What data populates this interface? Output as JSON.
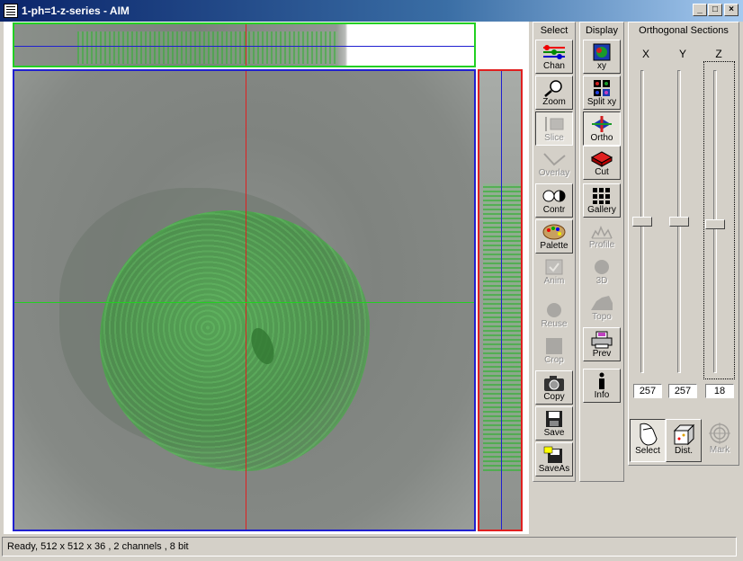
{
  "window": {
    "title": "1-ph=1-z-series - AIM"
  },
  "caption_buttons": {
    "minimize": "_",
    "maximize": "□",
    "close": "×"
  },
  "colors": {
    "xz_border": "#22d022",
    "xy_border": "#2020d0",
    "yz_border": "#e02020",
    "crosshair_x": "#e02020",
    "crosshair_y": "#22d022",
    "crosshair_blue": "#2020d0"
  },
  "select_panel": {
    "title": "Select",
    "tools": [
      {
        "label": "Chan",
        "icon": "channel-icon",
        "state": "raised"
      },
      {
        "label": "Zoom",
        "icon": "magnifier-icon",
        "state": "raised"
      },
      {
        "label": "Slice",
        "icon": "slice-icon",
        "state": "pressed-disabled"
      },
      {
        "label": "Overlay",
        "icon": "overlay-icon",
        "state": "disabled"
      },
      {
        "label": "Contr",
        "icon": "contrast-icon",
        "state": "raised"
      },
      {
        "label": "Palette",
        "icon": "palette-icon",
        "state": "raised"
      },
      {
        "label": "Anim",
        "icon": "animation-icon",
        "state": "disabled"
      },
      {
        "label": "Reuse",
        "icon": "reuse-icon",
        "state": "disabled"
      },
      {
        "label": "Crop",
        "icon": "crop-icon",
        "state": "disabled"
      },
      {
        "label": "Copy",
        "icon": "camera-icon",
        "state": "raised"
      },
      {
        "label": "Save",
        "icon": "floppy-icon",
        "state": "raised"
      },
      {
        "label": "SaveAs",
        "icon": "floppy-saveas-icon",
        "state": "raised"
      }
    ]
  },
  "display_panel": {
    "title": "Display",
    "tools": [
      {
        "label": "xy",
        "icon": "xy-icon",
        "state": "raised"
      },
      {
        "label": "Split xy",
        "icon": "split-xy-icon",
        "state": "raised"
      },
      {
        "label": "Ortho",
        "icon": "ortho-icon",
        "state": "pressed"
      },
      {
        "label": "Cut",
        "icon": "cut-icon",
        "state": "raised"
      },
      {
        "label": "Gallery",
        "icon": "gallery-icon",
        "state": "raised"
      },
      {
        "label": "Profile",
        "icon": "profile-icon",
        "state": "disabled"
      },
      {
        "label": "3D",
        "icon": "sphere-icon",
        "state": "disabled"
      },
      {
        "label": "Topo",
        "icon": "topography-icon",
        "state": "disabled"
      },
      {
        "label": "Prev",
        "icon": "printer-icon",
        "state": "raised"
      },
      {
        "label": "Info",
        "icon": "info-icon",
        "state": "raised"
      }
    ]
  },
  "ortho_panel": {
    "title": "Orthogonal Sections",
    "sliders": [
      {
        "label": "X",
        "value": "257",
        "fraction": 0.5
      },
      {
        "label": "Y",
        "value": "257",
        "fraction": 0.5
      },
      {
        "label": "Z",
        "value": "18",
        "fraction": 0.49
      }
    ],
    "modes": [
      {
        "label": "Select",
        "icon": "mouse-icon",
        "state": "pressed"
      },
      {
        "label": "Dist.",
        "icon": "distance-cube-icon",
        "state": "raised"
      },
      {
        "label": "Mark",
        "icon": "crosshair-target-icon",
        "state": "disabled"
      }
    ]
  },
  "status": {
    "text": "Ready, 512 x 512 x 36 , 2 channels , 8 bit"
  }
}
